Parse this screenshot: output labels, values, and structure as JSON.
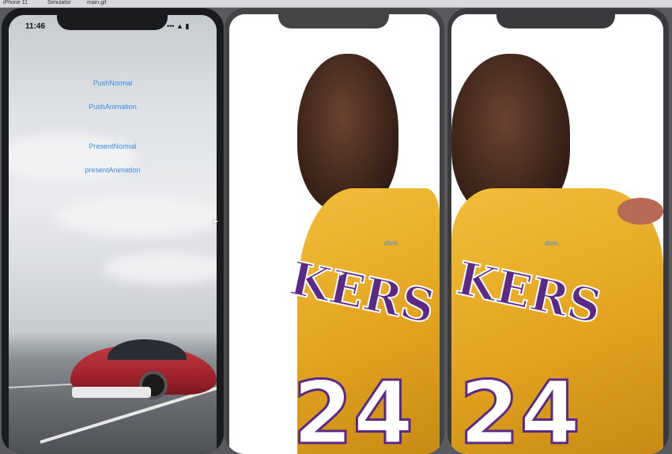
{
  "window_bar": {
    "items": [
      "iPhone 11",
      "Simulator",
      "main.gif"
    ]
  },
  "phone1": {
    "status_time": "11:46",
    "status_icons": "••• ▲ ▮",
    "menu": [
      {
        "label": "PushNormal"
      },
      {
        "label": "PushAnimation"
      },
      {
        "label": "PresentNormal"
      },
      {
        "label": "presentAnimation"
      }
    ]
  },
  "phone2": {
    "dismiss_label": "dism"
  },
  "phone3": {
    "dismiss_label": "dism"
  },
  "jersey": {
    "text": "KERS",
    "number": "24"
  },
  "colors": {
    "link": "#3b8cf0",
    "jersey_gold": "#f2be3a",
    "jersey_purple": "#5b2a86",
    "car_red": "#c23b44"
  }
}
